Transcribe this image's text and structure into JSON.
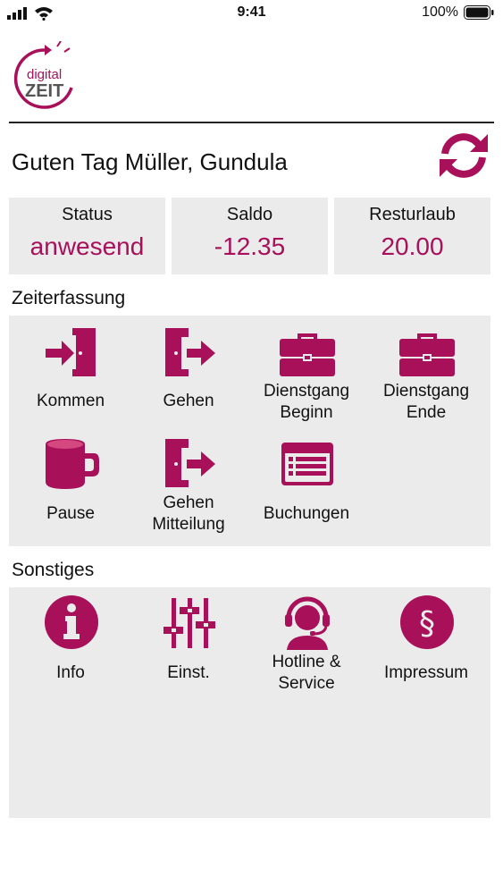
{
  "status_bar": {
    "time": "9:41",
    "battery": "100%"
  },
  "logo": {
    "line1": "digital",
    "line2": "ZEIT"
  },
  "greeting": "Guten Tag Müller, Gundula",
  "cards": [
    {
      "label": "Status",
      "value": "anwesend"
    },
    {
      "label": "Saldo",
      "value": "-12.35"
    },
    {
      "label": "Resturlaub",
      "value": "20.00"
    }
  ],
  "zeiterfassung": {
    "title": "Zeiterfassung",
    "items": [
      {
        "label": "Kommen",
        "icon": "door-enter-icon"
      },
      {
        "label": "Gehen",
        "icon": "door-exit-icon"
      },
      {
        "label": "Dienstgang\nBeginn",
        "icon": "briefcase-icon"
      },
      {
        "label": "Dienstgang\nEnde",
        "icon": "briefcase-icon"
      },
      {
        "label": "Pause",
        "icon": "coffee-cup-icon"
      },
      {
        "label": "Gehen\nMitteilung",
        "icon": "door-exit-icon"
      },
      {
        "label": "Buchungen",
        "icon": "list-icon"
      }
    ]
  },
  "sonstiges": {
    "title": "Sonstiges",
    "items": [
      {
        "label": "Info",
        "icon": "info-icon"
      },
      {
        "label": "Einst.",
        "icon": "sliders-icon"
      },
      {
        "label": "Hotline &\nService",
        "icon": "headset-icon"
      },
      {
        "label": "Impressum",
        "icon": "paragraph-icon"
      }
    ]
  },
  "colors": {
    "accent": "#a8105a",
    "panel": "#ebebeb"
  }
}
